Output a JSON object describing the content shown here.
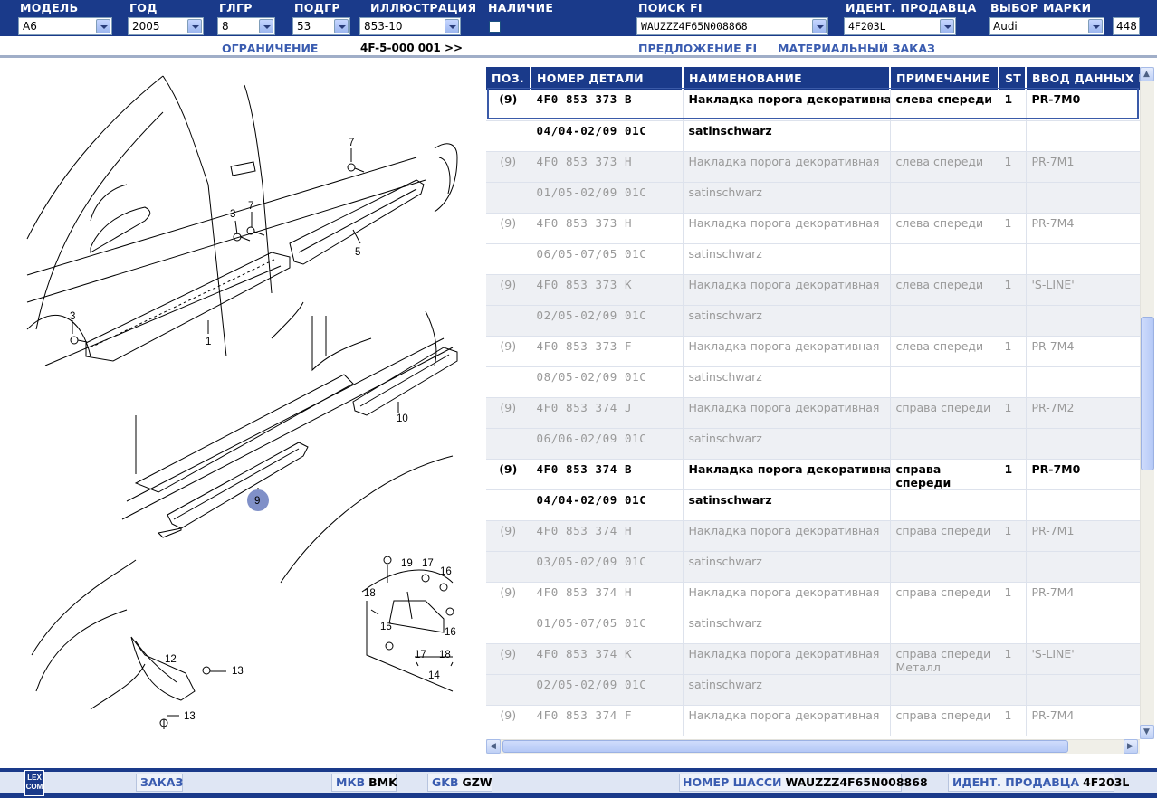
{
  "header": {
    "model": {
      "label": "МОДЕЛЬ",
      "value": "A6"
    },
    "year": {
      "label": "ГОД",
      "value": "2005"
    },
    "main_group": {
      "label": "ГЛГР",
      "value": "8"
    },
    "sub_group": {
      "label": "ПОДГР",
      "value": "53"
    },
    "illustration": {
      "label": "ИЛЛЮСТРАЦИЯ",
      "value": "853-10"
    },
    "availability": {
      "label": "НАЛИЧИЕ"
    },
    "search_fi": {
      "label": "ПОИСК FI",
      "value": "WAUZZZ4F65N008868"
    },
    "dealer_id": {
      "label": "ИДЕНТ. ПРОДАВЦА",
      "value": "4F203L"
    },
    "brand": {
      "label": "ВЫБОР МАРКИ",
      "value": "Audi"
    },
    "brand_code": "448"
  },
  "subheader": {
    "restriction": "ОГРАНИЧЕНИЕ",
    "restriction_value": "4F-5-000 001 >>",
    "offer_fi": "ПРЕДЛОЖЕНИЕ FI",
    "material_order": "МАТЕРИАЛЬНЫЙ ЗАКАЗ"
  },
  "illustration": {
    "callouts": [
      "1",
      "3",
      "3",
      "5",
      "7",
      "7",
      "9",
      "10",
      "12",
      "13",
      "13",
      "14",
      "15",
      "16",
      "16",
      "17",
      "17",
      "18",
      "18",
      "19"
    ],
    "highlighted_callout": "9"
  },
  "table": {
    "columns": [
      "ПОЗ.",
      "НОМЕР ДЕТАЛИ",
      "НАИМЕНОВАНИЕ",
      "ПРИМЕЧАНИЕ",
      "ST",
      "ВВОД ДАННЫХ ПО"
    ],
    "rows": [
      {
        "pos": "(9)",
        "part": "4F0 853 373 B",
        "name": "Накладка порога декоративная",
        "note": "слева спереди",
        "st": "1",
        "data": "PR-7M0",
        "active": true,
        "selected": true
      },
      {
        "pos": "",
        "part": "04/04-02/09 01C",
        "name": "satinschwarz",
        "note": "",
        "st": "",
        "data": "",
        "active": true
      },
      {
        "pos": "(9)",
        "part": "4F0 853 373 H",
        "name": "Накладка порога декоративная",
        "note": "слева спереди",
        "st": "1",
        "data": "PR-7M1"
      },
      {
        "pos": "",
        "part": "01/05-02/09 01C",
        "name": "satinschwarz",
        "note": "",
        "st": "",
        "data": ""
      },
      {
        "pos": "(9)",
        "part": "4F0 853 373 H",
        "name": "Накладка порога декоративная",
        "note": "слева спереди",
        "st": "1",
        "data": "PR-7M4"
      },
      {
        "pos": "",
        "part": "06/05-07/05 01C",
        "name": "satinschwarz",
        "note": "",
        "st": "",
        "data": ""
      },
      {
        "pos": "(9)",
        "part": "4F0 853 373 K",
        "name": "Накладка порога декоративная",
        "note": "слева спереди",
        "st": "1",
        "data": "'S-LINE'"
      },
      {
        "pos": "",
        "part": "02/05-02/09 01C",
        "name": "satinschwarz",
        "note": "",
        "st": "",
        "data": ""
      },
      {
        "pos": "(9)",
        "part": "4F0 853 373 F",
        "name": "Накладка порога декоративная",
        "note": "слева спереди",
        "st": "1",
        "data": "PR-7M4"
      },
      {
        "pos": "",
        "part": "08/05-02/09 01C",
        "name": "satinschwarz",
        "note": "",
        "st": "",
        "data": ""
      },
      {
        "pos": "(9)",
        "part": "4F0 853 374 J",
        "name": "Накладка порога декоративная",
        "note": "справа спереди",
        "st": "1",
        "data": "PR-7M2"
      },
      {
        "pos": "",
        "part": "06/06-02/09 01C",
        "name": "satinschwarz",
        "note": "",
        "st": "",
        "data": ""
      },
      {
        "pos": "(9)",
        "part": "4F0 853 374 B",
        "name": "Накладка порога декоративная",
        "note": "справа спереди",
        "st": "1",
        "data": "PR-7M0",
        "active": true
      },
      {
        "pos": "",
        "part": "04/04-02/09 01C",
        "name": "satinschwarz",
        "note": "",
        "st": "",
        "data": "",
        "active": true
      },
      {
        "pos": "(9)",
        "part": "4F0 853 374 H",
        "name": "Накладка порога декоративная",
        "note": "справа спереди",
        "st": "1",
        "data": "PR-7M1"
      },
      {
        "pos": "",
        "part": "03/05-02/09 01C",
        "name": "satinschwarz",
        "note": "",
        "st": "",
        "data": ""
      },
      {
        "pos": "(9)",
        "part": "4F0 853 374 H",
        "name": "Накладка порога декоративная",
        "note": "справа спереди",
        "st": "1",
        "data": "PR-7M4"
      },
      {
        "pos": "",
        "part": "01/05-07/05 01C",
        "name": "satinschwarz",
        "note": "",
        "st": "",
        "data": ""
      },
      {
        "pos": "(9)",
        "part": "4F0 853 374 K",
        "name": "Накладка порога декоративная",
        "note": "справа спереди Металл",
        "st": "1",
        "data": "'S-LINE'"
      },
      {
        "pos": "",
        "part": "02/05-02/09 01C",
        "name": "satinschwarz",
        "note": "",
        "st": "",
        "data": ""
      },
      {
        "pos": "(9)",
        "part": "4F0 853 374 F",
        "name": "Накладка порога декоративная",
        "note": "справа спереди",
        "st": "1",
        "data": "PR-7M4"
      }
    ]
  },
  "footer": {
    "logo_text": "LEX COM",
    "order": "ЗАКАЗ",
    "mkb_label": "МКВ",
    "mkb_value": "BMK",
    "gkb_label": "GKB",
    "gkb_value": "GZW",
    "chassis_label": "НОМЕР ШАССИ",
    "chassis_value": "WAUZZZ4F65N008868",
    "dealer_label": "ИДЕНТ. ПРОДАВЦА",
    "dealer_value": "4F203L"
  },
  "colors": {
    "header_bg": "#1a3a8a",
    "link": "#3a5cb0",
    "highlight_callout": "#8090c8"
  }
}
